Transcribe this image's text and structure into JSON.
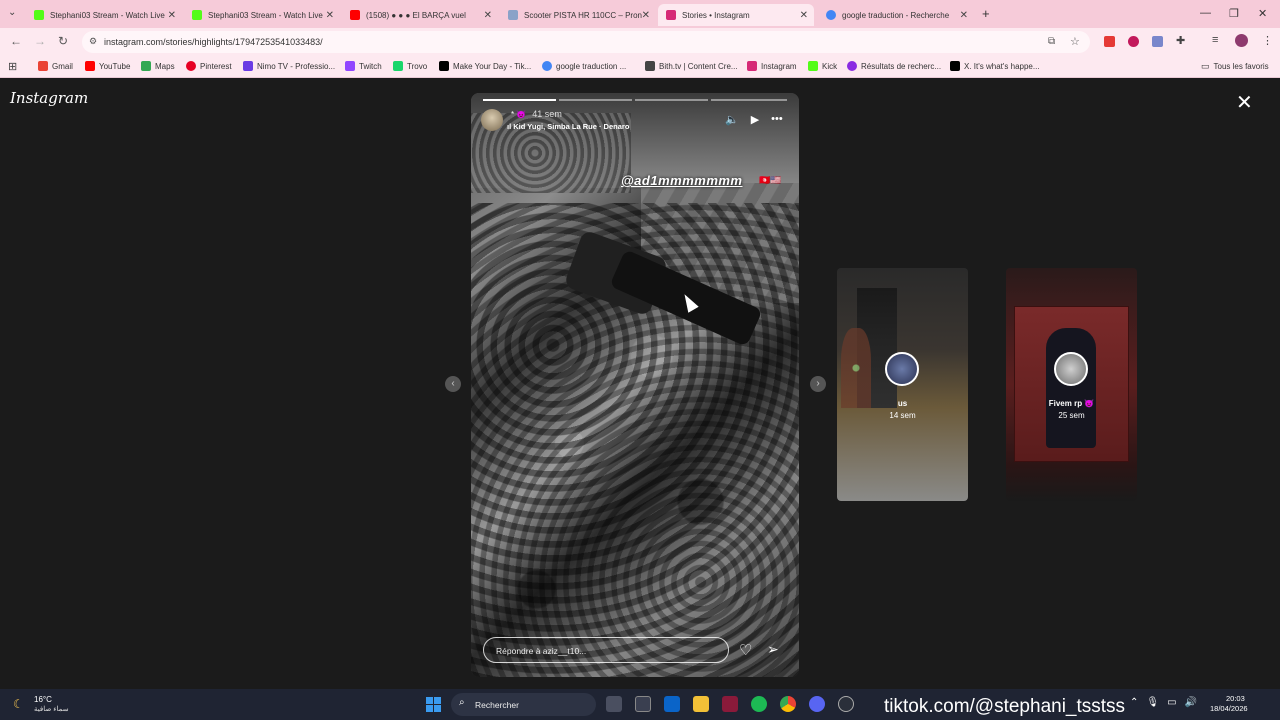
{
  "browser": {
    "tabs": [
      {
        "title": "Stephani03 Stream - Watch Live",
        "favicon_color": "#53fc18",
        "active": false
      },
      {
        "title": "Stephani03 Stream - Watch Live",
        "favicon_color": "#53fc18",
        "active": false
      },
      {
        "title": "(1508) ● ● ● El BARÇA vuel",
        "favicon_color": "#ff0000",
        "active": false
      },
      {
        "title": "Scooter PISTA HR 110CC – Pron",
        "favicon_color": "#8aa2c8",
        "active": false
      },
      {
        "title": "Stories • Instagram",
        "favicon_color": "#d62976",
        "active": true
      },
      {
        "title": "google traduction - Recherche",
        "favicon_color": "#4285f4",
        "active": false
      }
    ],
    "new_tab": "+",
    "url": "instagram.com/stories/highlights/17947253541033483/",
    "bookmarks": [
      {
        "label": "Gmail",
        "color": "#ea4335"
      },
      {
        "label": "YouTube",
        "color": "#ff0000"
      },
      {
        "label": "Maps",
        "color": "#34a853"
      },
      {
        "label": "Pinterest",
        "color": "#e60023"
      },
      {
        "label": "Nimo TV - Professio...",
        "color": "#6a3be4"
      },
      {
        "label": "Twitch",
        "color": "#9146ff"
      },
      {
        "label": "Trovo",
        "color": "#19d66b"
      },
      {
        "label": "Make Your Day - Tik...",
        "color": "#000000"
      },
      {
        "label": "google traduction ...",
        "color": "#4285f4"
      },
      {
        "label": "Bith.tv | Content Cre...",
        "color": "#444444"
      },
      {
        "label": "Instagram",
        "color": "#d62976"
      },
      {
        "label": "Kick",
        "color": "#53fc18"
      },
      {
        "label": "Résultats de recherc...",
        "color": "#8a2be2"
      },
      {
        "label": "X. It's what's happe...",
        "color": "#000000"
      }
    ],
    "all_bookmarks": "Tous les favoris"
  },
  "instagram": {
    "logo": "Instagram",
    "story": {
      "time": "41 sem",
      "music": "Kid Yugi, Simba La Rue · Denaro",
      "mention": "@ad1mmmmmmm",
      "reply_placeholder": "Répondre à aziz__t10...",
      "progress_segments": 4,
      "progress_completed": 1
    },
    "next_stories": [
      {
        "title": "us",
        "time": "14 sem",
        "bg": "#4a4238"
      },
      {
        "title": "Fivem rp 👿",
        "time": "25 sem",
        "bg": "#3a1c1c"
      }
    ]
  },
  "taskbar": {
    "temperature": "16°C",
    "weather_desc": "سماء صافية",
    "search_placeholder": "Rechercher",
    "overlay_text": "tiktok.com/@stephani_tsstss",
    "time": "20:03",
    "date": "18/04/2026"
  }
}
